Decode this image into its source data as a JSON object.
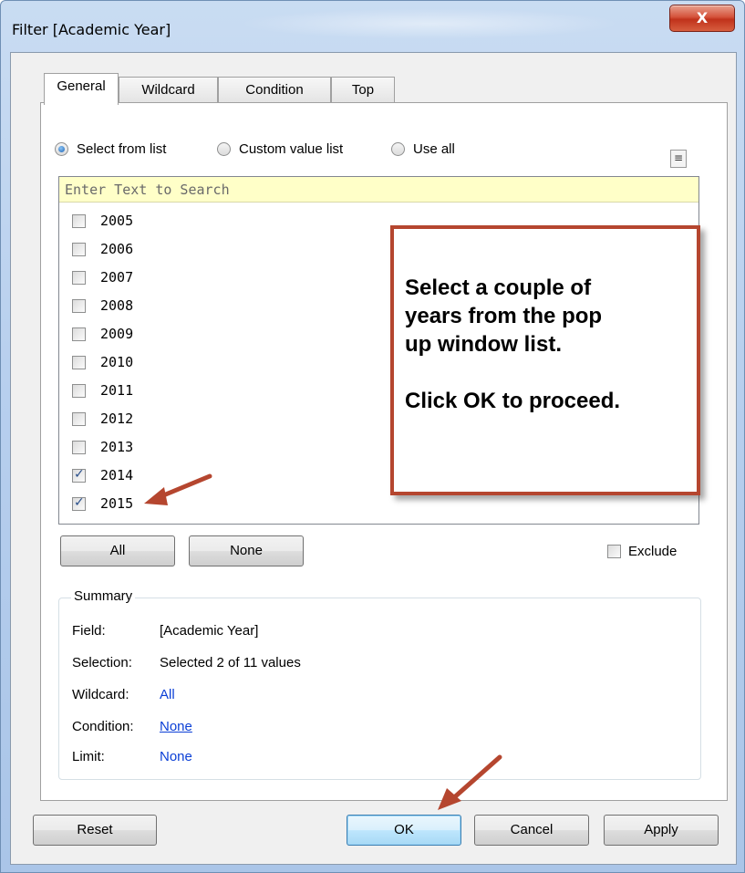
{
  "window": {
    "title": "Filter [Academic Year]",
    "close_glyph": "X",
    "close_icon": "close-icon"
  },
  "tabs": [
    {
      "label": "General",
      "active": true
    },
    {
      "label": "Wildcard",
      "active": false
    },
    {
      "label": "Condition",
      "active": false
    },
    {
      "label": "Top",
      "active": false
    }
  ],
  "general": {
    "options": [
      {
        "label": "Select from list",
        "selected": true
      },
      {
        "label": "Custom value list",
        "selected": false
      },
      {
        "label": "Use all",
        "selected": false
      }
    ],
    "list_menu_icon": "list-menu-icon",
    "search": {
      "placeholder": "Enter Text to Search",
      "value": ""
    },
    "values": [
      {
        "label": "2005",
        "checked": false
      },
      {
        "label": "2006",
        "checked": false
      },
      {
        "label": "2007",
        "checked": false
      },
      {
        "label": "2008",
        "checked": false
      },
      {
        "label": "2009",
        "checked": false
      },
      {
        "label": "2010",
        "checked": false
      },
      {
        "label": "2011",
        "checked": false
      },
      {
        "label": "2012",
        "checked": false
      },
      {
        "label": "2013",
        "checked": false
      },
      {
        "label": "2014",
        "checked": true
      },
      {
        "label": "2015",
        "checked": true
      }
    ],
    "all_label": "All",
    "none_label": "None",
    "exclude_label": "Exclude",
    "exclude_checked": false
  },
  "callout": {
    "text": "Select a couple of\nyears from the pop\nup window list.\n\nClick OK to proceed.",
    "border_color": "#b5462f"
  },
  "annotation_arrow_color": "#b5462f",
  "summary": {
    "legend": "Summary",
    "rows": [
      {
        "key": "Field:",
        "value": "[Academic Year]",
        "style": "plain"
      },
      {
        "key": "Selection:",
        "value": "Selected 2 of 11 values",
        "style": "plain"
      },
      {
        "key": "Wildcard:",
        "value": "All",
        "style": "link"
      },
      {
        "key": "Condition:",
        "value": "None",
        "style": "link-underline"
      },
      {
        "key": "Limit:",
        "value": "None",
        "style": "link"
      }
    ]
  },
  "footer": {
    "reset_label": "Reset",
    "ok_label": "OK",
    "cancel_label": "Cancel",
    "apply_label": "Apply"
  },
  "colors": {
    "titlebar": "#c9dcf2",
    "search_bg": "#ffffc8",
    "link": "#0b3fd6",
    "client_bg": "#f0f0f0"
  }
}
